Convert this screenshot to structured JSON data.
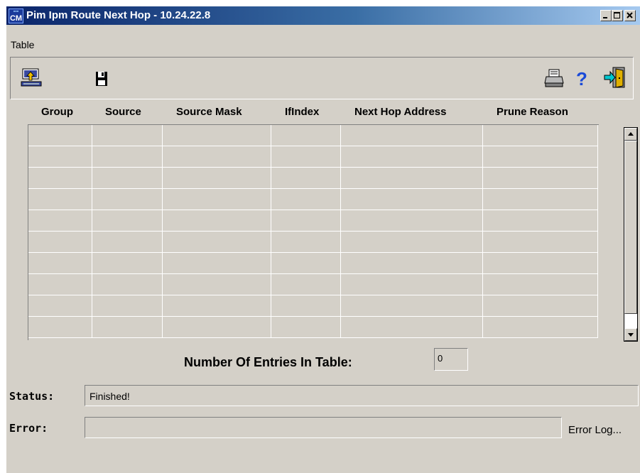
{
  "window": {
    "title": "Pim Ipm Route Next Hop - 10.24.22.8",
    "app_icon_text": "CM"
  },
  "menu": {
    "items": [
      "Table"
    ]
  },
  "toolbar": {
    "left_icons": [
      "retrieve-table-icon",
      "save-disk-icon"
    ],
    "right_icons": [
      "printer-icon",
      "help-icon",
      "exit-door-icon"
    ]
  },
  "table": {
    "columns": [
      "Group",
      "Source",
      "Source Mask",
      "IfIndex",
      "Next Hop Address",
      "Prune Reason"
    ],
    "rows": []
  },
  "entries": {
    "label": "Number Of Entries In Table:",
    "value": "0"
  },
  "status": {
    "label": "Status:",
    "value": "Finished!"
  },
  "error": {
    "label": "Error:",
    "value": "",
    "log_link": "Error Log..."
  },
  "colors": {
    "face": "#d4d0c8",
    "title_start": "#0a246a",
    "title_end": "#a6caf0"
  }
}
